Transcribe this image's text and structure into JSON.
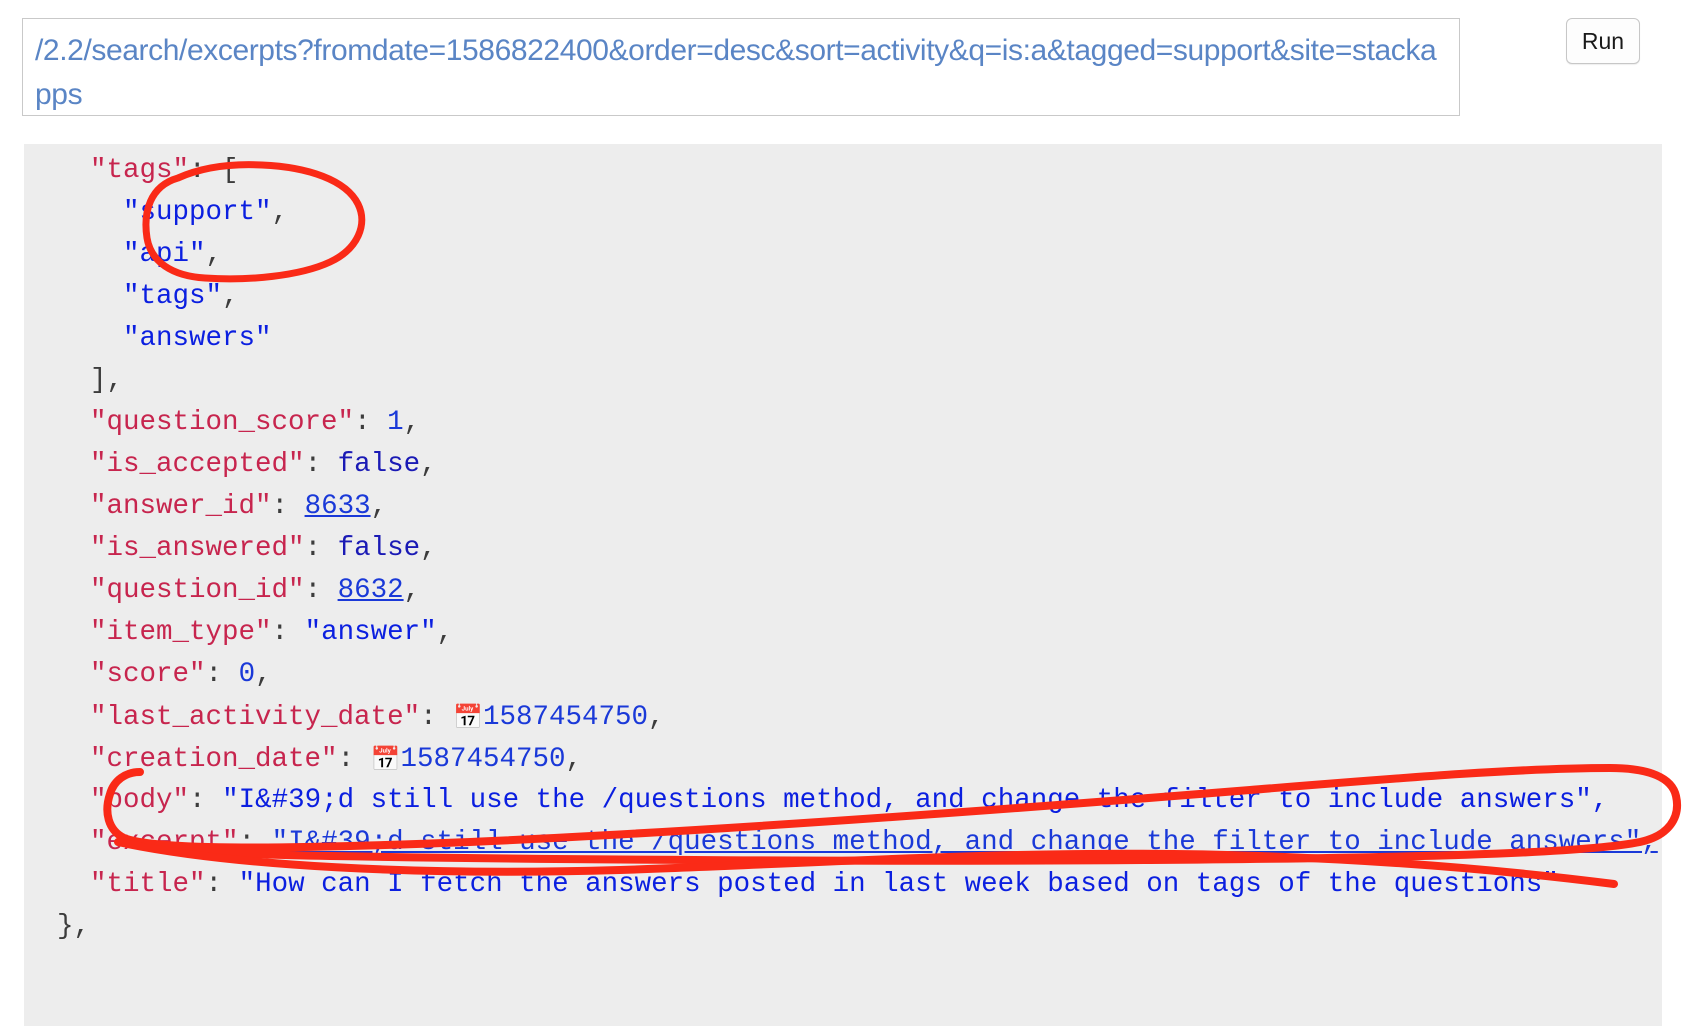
{
  "toolbar": {
    "url_value": "/2.2/search/excerpts?fromdate=1586822400&order=desc&sort=activity&q=is:a&tagged=support&site=stackapps",
    "url_placeholder": "/2.2/...",
    "run_label": "Run",
    "url_color": "#5a85c5"
  },
  "response": {
    "background_color": "#ededed",
    "key_color": "#c7254e",
    "string_color": "#0b1fe0",
    "punctuation_color": "#3c3c3c",
    "calendar_icon": "📅",
    "lines": [
      {
        "indent": 4,
        "segments": [
          {
            "t": "\"tags\"",
            "c": "k"
          },
          {
            "t": ": [",
            "c": "p"
          }
        ]
      },
      {
        "indent": 6,
        "segments": [
          {
            "t": "\"support\"",
            "c": "s"
          },
          {
            "t": ",",
            "c": "p"
          }
        ]
      },
      {
        "indent": 6,
        "segments": [
          {
            "t": "\"api\"",
            "c": "s"
          },
          {
            "t": ",",
            "c": "p"
          }
        ]
      },
      {
        "indent": 6,
        "segments": [
          {
            "t": "\"tags\"",
            "c": "s"
          },
          {
            "t": ",",
            "c": "p"
          }
        ]
      },
      {
        "indent": 6,
        "segments": [
          {
            "t": "\"answers\"",
            "c": "s"
          }
        ]
      },
      {
        "indent": 4,
        "segments": [
          {
            "t": "],",
            "c": "p"
          }
        ]
      },
      {
        "indent": 4,
        "segments": [
          {
            "t": "\"question_score\"",
            "c": "k"
          },
          {
            "t": ": ",
            "c": "p"
          },
          {
            "t": "1",
            "c": "num"
          },
          {
            "t": ",",
            "c": "p"
          }
        ]
      },
      {
        "indent": 4,
        "segments": [
          {
            "t": "\"is_accepted\"",
            "c": "k"
          },
          {
            "t": ": ",
            "c": "p"
          },
          {
            "t": "false",
            "c": "bool"
          },
          {
            "t": ",",
            "c": "p"
          }
        ]
      },
      {
        "indent": 4,
        "segments": [
          {
            "t": "\"answer_id\"",
            "c": "k"
          },
          {
            "t": ": ",
            "c": "p"
          },
          {
            "t": "8633",
            "c": "lnk"
          },
          {
            "t": ",",
            "c": "p"
          }
        ]
      },
      {
        "indent": 4,
        "segments": [
          {
            "t": "\"is_answered\"",
            "c": "k"
          },
          {
            "t": ": ",
            "c": "p"
          },
          {
            "t": "false",
            "c": "bool"
          },
          {
            "t": ",",
            "c": "p"
          }
        ]
      },
      {
        "indent": 4,
        "segments": [
          {
            "t": "\"question_id\"",
            "c": "k"
          },
          {
            "t": ": ",
            "c": "p"
          },
          {
            "t": "8632",
            "c": "lnk"
          },
          {
            "t": ",",
            "c": "p"
          }
        ]
      },
      {
        "indent": 4,
        "segments": [
          {
            "t": "\"item_type\"",
            "c": "k"
          },
          {
            "t": ": ",
            "c": "p"
          },
          {
            "t": "\"answer\"",
            "c": "s"
          },
          {
            "t": ",",
            "c": "p"
          }
        ]
      },
      {
        "indent": 4,
        "segments": [
          {
            "t": "\"score\"",
            "c": "k"
          },
          {
            "t": ": ",
            "c": "p"
          },
          {
            "t": "0",
            "c": "num"
          },
          {
            "t": ",",
            "c": "p"
          }
        ]
      },
      {
        "indent": 4,
        "segments": [
          {
            "t": "\"last_activity_date\"",
            "c": "k"
          },
          {
            "t": ": ",
            "c": "p"
          },
          {
            "t": "📅",
            "c": "cal"
          },
          {
            "t": "1587454750",
            "c": "num"
          },
          {
            "t": ",",
            "c": "p"
          }
        ]
      },
      {
        "indent": 4,
        "segments": [
          {
            "t": "\"creation_date\"",
            "c": "k"
          },
          {
            "t": ": ",
            "c": "p"
          },
          {
            "t": "📅",
            "c": "cal"
          },
          {
            "t": "1587454750",
            "c": "num"
          },
          {
            "t": ",",
            "c": "p"
          }
        ]
      },
      {
        "indent": 4,
        "segments": [
          {
            "t": "\"body\"",
            "c": "k"
          },
          {
            "t": ": ",
            "c": "p"
          },
          {
            "t": "\"I&#39;d still use the /questions method, and change the filter to include answers\",",
            "c": "s"
          }
        ]
      },
      {
        "indent": 4,
        "segments": [
          {
            "t": "\"excerpt\"",
            "c": "k"
          },
          {
            "t": ": ",
            "c": "p"
          },
          {
            "t": "\"I&#39;d still use the /questions method, and change the filter to include answers\",",
            "c": "lnk"
          }
        ]
      },
      {
        "indent": 4,
        "segments": [
          {
            "t": "\"title\"",
            "c": "k"
          },
          {
            "t": ": ",
            "c": "p"
          },
          {
            "t": "\"How can I fetch the answers posted in last week based on tags of the questions\"",
            "c": "s"
          }
        ]
      },
      {
        "indent": 2,
        "segments": [
          {
            "t": "},",
            "c": "p"
          }
        ]
      }
    ]
  },
  "annotations": {
    "stroke_color": "#fa2a17",
    "marks": [
      {
        "name": "circle-around-support-tag",
        "shape": "ellipse"
      },
      {
        "name": "circle-around-body-line",
        "shape": "loop"
      },
      {
        "name": "strikethrough-excerpt-line",
        "shape": "line"
      }
    ]
  }
}
